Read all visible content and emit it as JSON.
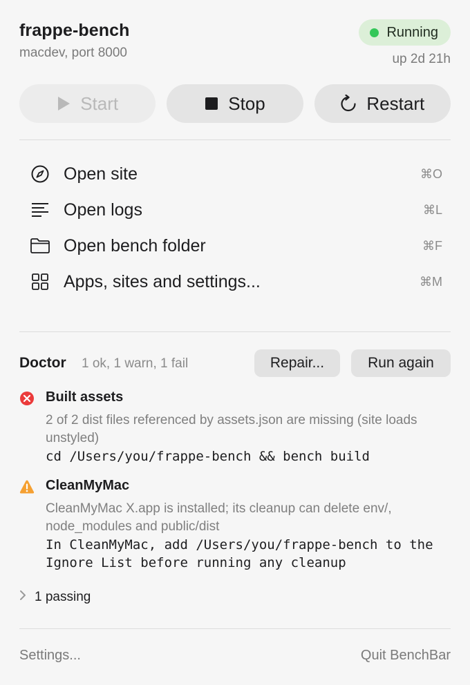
{
  "header": {
    "title": "frappe-bench",
    "subtitle": "macdev, port 8000",
    "status": "Running",
    "uptime": "up 2d 21h"
  },
  "controls": {
    "start_label": "Start",
    "stop_label": "Stop",
    "restart_label": "Restart"
  },
  "menu": {
    "items": [
      {
        "label": "Open site",
        "shortcut": "⌘O",
        "icon": "compass-icon"
      },
      {
        "label": "Open logs",
        "shortcut": "⌘L",
        "icon": "lines-icon"
      },
      {
        "label": "Open bench folder",
        "shortcut": "⌘F",
        "icon": "folder-icon"
      },
      {
        "label": "Apps, sites and settings...",
        "shortcut": "⌘M",
        "icon": "grid-icon"
      }
    ]
  },
  "doctor": {
    "title": "Doctor",
    "summary": "1 ok, 1 warn, 1 fail",
    "repair_label": "Repair...",
    "run_again_label": "Run again",
    "checks": [
      {
        "status": "fail",
        "icon": "error-icon",
        "title": "Built assets",
        "description": "2 of 2 dist files referenced by assets.json are missing (site loads unstyled)",
        "command": "cd /Users/you/frappe-bench && bench build"
      },
      {
        "status": "warn",
        "icon": "warning-icon",
        "title": "CleanMyMac",
        "description": "CleanMyMac X.app is installed; its cleanup can delete env/, node_modules and public/dist",
        "command": "In CleanMyMac, add /Users/you/frappe-bench to the Ignore List before running any cleanup"
      }
    ],
    "passing_label": "1 passing"
  },
  "footer": {
    "settings_label": "Settings...",
    "quit_label": "Quit BenchBar"
  },
  "colors": {
    "running": "#34c759",
    "running_badge_bg": "#dcefd8",
    "fail": "#eb3b3b",
    "warn": "#f5a031"
  }
}
